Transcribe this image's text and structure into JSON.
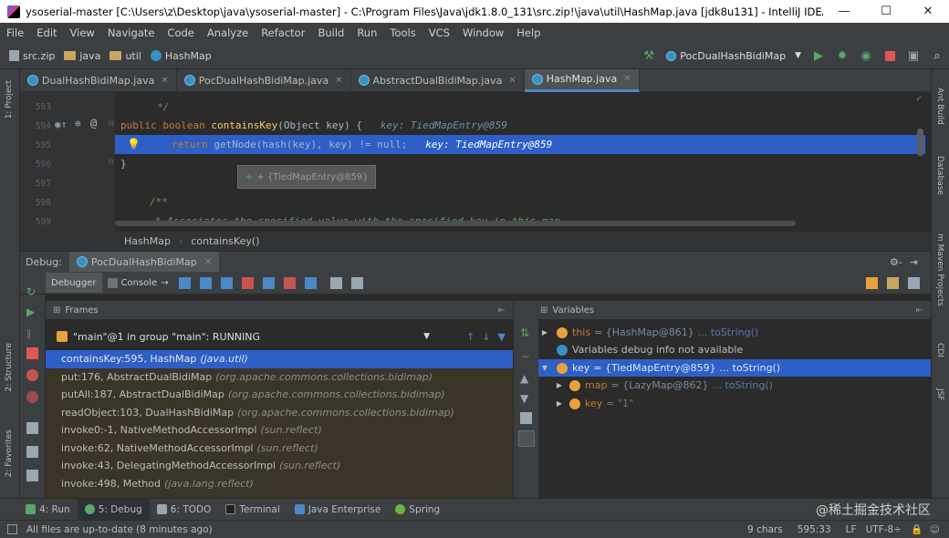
{
  "window": {
    "title": "ysoserial-master [C:\\Users\\z\\Desktop\\java\\ysoserial-master] - C:\\Program Files\\Java\\jdk1.8.0_131\\src.zip!\\java\\util\\HashMap.java [jdk8u131] - IntelliJ IDEA",
    "minimize": "—",
    "maximize": "☐",
    "close": "✕"
  },
  "menu": [
    "File",
    "Edit",
    "View",
    "Navigate",
    "Code",
    "Analyze",
    "Refactor",
    "Build",
    "Run",
    "Tools",
    "VCS",
    "Window",
    "Help"
  ],
  "navbar": {
    "crumbs": [
      "src.zip",
      "java",
      "util",
      "HashMap"
    ],
    "run_config": "PocDualHashBidiMap"
  },
  "tabs": [
    {
      "label": "DualHashBidiMap.java"
    },
    {
      "label": "PocDualHashBidiMap.java"
    },
    {
      "label": "AbstractDualBidiMap.java"
    },
    {
      "label": "HashMap.java"
    }
  ],
  "editor": {
    "line_numbers": [
      "593",
      "594",
      "595",
      "596",
      "597",
      "598",
      "599"
    ],
    "comment_end": "*/",
    "method_sig_kw1": "public",
    "method_sig_kw2": "boolean",
    "method_name": "containsKey",
    "method_params": "(Object key) {",
    "method_hint": "key: TiedMapEntry@859",
    "exec_return": "return",
    "exec_call": "getNode",
    "exec_args": "(hash(key),",
    "exec_rest": "key) != null;",
    "exec_hint": "key: TiedMapEntry@859",
    "closing_brace": "}",
    "javadoc_start": "/**",
    "javadoc_text": "* Associates the specified value with the specified key in this map.",
    "tooltip": "+ {TiedMapEntry@859}"
  },
  "editor_breadcrumb": [
    "HashMap",
    "containsKey()"
  ],
  "debug": {
    "label": "Debug:",
    "config": "PocDualHashBidiMap",
    "tabs": [
      "Debugger",
      "Console"
    ],
    "frames_title": "Frames",
    "variables_title": "Variables",
    "thread": "\"main\"@1 in group \"main\": RUNNING",
    "frames": [
      {
        "method": "containsKey:595, HashMap",
        "pkg": "(java.util)"
      },
      {
        "method": "put:176, AbstractDualBidiMap",
        "pkg": "(org.apache.commons.collections.bidimap)"
      },
      {
        "method": "putAll:187, AbstractDualBidiMap",
        "pkg": "(org.apache.commons.collections.bidimap)"
      },
      {
        "method": "readObject:103, DualHashBidiMap",
        "pkg": "(org.apache.commons.collections.bidimap)"
      },
      {
        "method": "invoke0:-1, NativeMethodAccessorImpl",
        "pkg": "(sun.reflect)"
      },
      {
        "method": "invoke:62, NativeMethodAccessorImpl",
        "pkg": "(sun.reflect)"
      },
      {
        "method": "invoke:43, DelegatingMethodAccessorImpl",
        "pkg": "(sun.reflect)"
      },
      {
        "method": "invoke:498, Method",
        "pkg": "(java.lang.reflect)"
      }
    ],
    "variables": {
      "this_name": "this",
      "this_val": "= {HashMap@861}",
      "this_link": "... toString()",
      "info": "Variables debug info not available",
      "key_name": "key",
      "key_val": "= {TiedMapEntry@859}",
      "key_link": "... toString()",
      "map_name": "map",
      "map_val": "= {LazyMap@862}",
      "map_link": "... toString()",
      "key2_name": "key",
      "key2_val": "= \"1\""
    }
  },
  "stripes": {
    "left": [
      "1: Project",
      "2: Structure",
      "2: Favorites"
    ],
    "right": [
      "Ant Build",
      "Database",
      "m Maven Projects",
      "CDI",
      "JSF"
    ]
  },
  "tooltabs": [
    "4: Run",
    "5: Debug",
    "6: TODO",
    "Terminal",
    "Java Enterprise",
    "Spring"
  ],
  "status": {
    "message": "All files are up-to-date (8 minutes ago)",
    "chars": "9 chars",
    "position": "595:33",
    "line_sep": "LF",
    "encoding": "UTF-8÷"
  },
  "watermark": "@稀土掘金技术社区",
  "colors": {
    "accent": "#2d5fc7",
    "run_green": "#59a869",
    "stop_red": "#e05555"
  }
}
